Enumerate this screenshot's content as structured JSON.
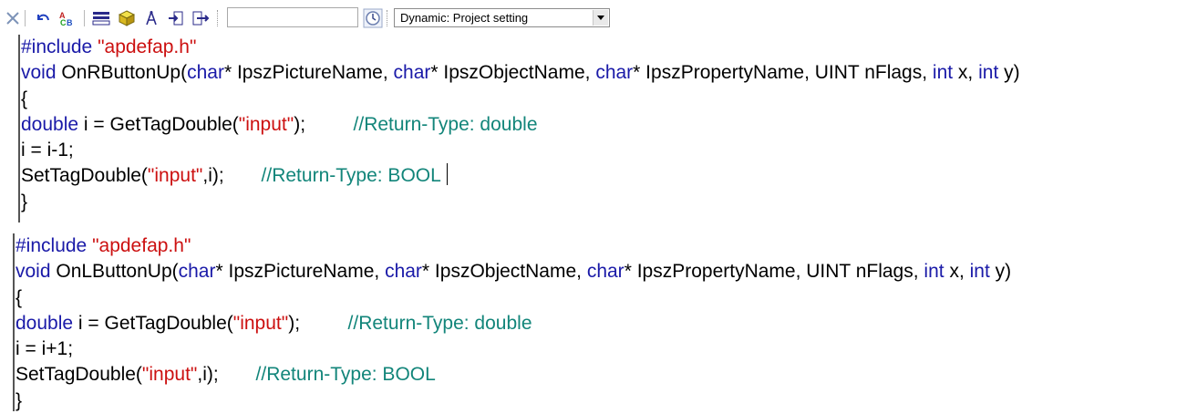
{
  "toolbar": {
    "buttons": [
      {
        "name": "close-icon"
      },
      {
        "name": "undo-icon"
      },
      {
        "name": "compile-icon"
      },
      {
        "name": "tag-list-icon"
      },
      {
        "name": "cube-icon"
      },
      {
        "name": "compass-icon"
      },
      {
        "name": "import-icon"
      },
      {
        "name": "export-icon"
      }
    ],
    "search_value": "",
    "trigger_icon": "clock-icon",
    "dropdown_selected": "Dynamic: Project setting"
  },
  "panels": [
    {
      "lines": [
        [
          {
            "t": "#include ",
            "c": "kw"
          },
          {
            "t": "\"apdefap.h\"",
            "c": "str"
          }
        ],
        [
          {
            "t": "void",
            "c": "kw"
          },
          {
            "t": " OnRButtonUp(",
            "c": ""
          },
          {
            "t": "char",
            "c": "kw"
          },
          {
            "t": "* IpszPictureName, ",
            "c": ""
          },
          {
            "t": "char",
            "c": "kw"
          },
          {
            "t": "* IpszObjectName, ",
            "c": ""
          },
          {
            "t": "char",
            "c": "kw"
          },
          {
            "t": "* IpszPropertyName, UINT nFlags, ",
            "c": ""
          },
          {
            "t": "int",
            "c": "kw"
          },
          {
            "t": " x, ",
            "c": ""
          },
          {
            "t": "int",
            "c": "kw"
          },
          {
            "t": " y)",
            "c": ""
          }
        ],
        [
          {
            "t": "{",
            "c": ""
          }
        ],
        [
          {
            "t": "double",
            "c": "kw"
          },
          {
            "t": " i = GetTagDouble(",
            "c": ""
          },
          {
            "t": "\"input\"",
            "c": "str"
          },
          {
            "t": ");         ",
            "c": ""
          },
          {
            "t": "//Return-Type: double",
            "c": "cm"
          }
        ],
        [
          {
            "t": "i = i-1;",
            "c": ""
          }
        ],
        [
          {
            "t": "SetTagDouble(",
            "c": ""
          },
          {
            "t": "\"input\"",
            "c": "str"
          },
          {
            "t": ",i);       ",
            "c": ""
          },
          {
            "t": "//Return-Type: BOOL",
            "c": "cm"
          }
        ],
        [
          {
            "t": "}",
            "c": ""
          }
        ]
      ]
    },
    {
      "lines": [
        [
          {
            "t": "#include ",
            "c": "kw"
          },
          {
            "t": "\"apdefap.h\"",
            "c": "str"
          }
        ],
        [
          {
            "t": "void",
            "c": "kw"
          },
          {
            "t": " OnLButtonUp(",
            "c": ""
          },
          {
            "t": "char",
            "c": "kw"
          },
          {
            "t": "* IpszPictureName, ",
            "c": ""
          },
          {
            "t": "char",
            "c": "kw"
          },
          {
            "t": "* IpszObjectName, ",
            "c": ""
          },
          {
            "t": "char",
            "c": "kw"
          },
          {
            "t": "* IpszPropertyName, UINT nFlags, ",
            "c": ""
          },
          {
            "t": "int",
            "c": "kw"
          },
          {
            "t": " x, ",
            "c": ""
          },
          {
            "t": "int",
            "c": "kw"
          },
          {
            "t": " y)",
            "c": ""
          }
        ],
        [
          {
            "t": "{",
            "c": ""
          }
        ],
        [
          {
            "t": "double",
            "c": "kw"
          },
          {
            "t": " i = GetTagDouble(",
            "c": ""
          },
          {
            "t": "\"input\"",
            "c": "str"
          },
          {
            "t": ");         ",
            "c": ""
          },
          {
            "t": "//Return-Type: double",
            "c": "cm"
          }
        ],
        [
          {
            "t": "i = i+1;",
            "c": ""
          }
        ],
        [
          {
            "t": "SetTagDouble(",
            "c": ""
          },
          {
            "t": "\"input\"",
            "c": "str"
          },
          {
            "t": ",i);       ",
            "c": ""
          },
          {
            "t": "//Return-Type: BOOL",
            "c": "cm"
          }
        ],
        [
          {
            "t": "}",
            "c": ""
          }
        ]
      ]
    }
  ]
}
